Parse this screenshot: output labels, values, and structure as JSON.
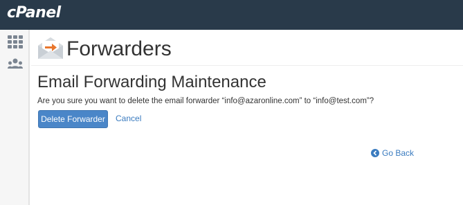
{
  "header": {
    "logo_text": "cPanel"
  },
  "sidebar": {
    "items": [
      {
        "icon": "grid-icon"
      },
      {
        "icon": "users-icon"
      }
    ]
  },
  "page": {
    "title": "Forwarders",
    "icon": "envelope-forward-icon"
  },
  "section": {
    "title": "Email Forwarding Maintenance",
    "confirm_text": "Are you sure you want to delete the email forwarder “info@azaronline.com” to “info@test.com”?"
  },
  "actions": {
    "delete_label": "Delete Forwarder",
    "cancel_label": "Cancel",
    "go_back_label": "Go Back"
  },
  "colors": {
    "topbar": "#293a4a",
    "primary_button": "#4a86c8",
    "link": "#3a7bbf",
    "accent_orange": "#e8762d"
  }
}
